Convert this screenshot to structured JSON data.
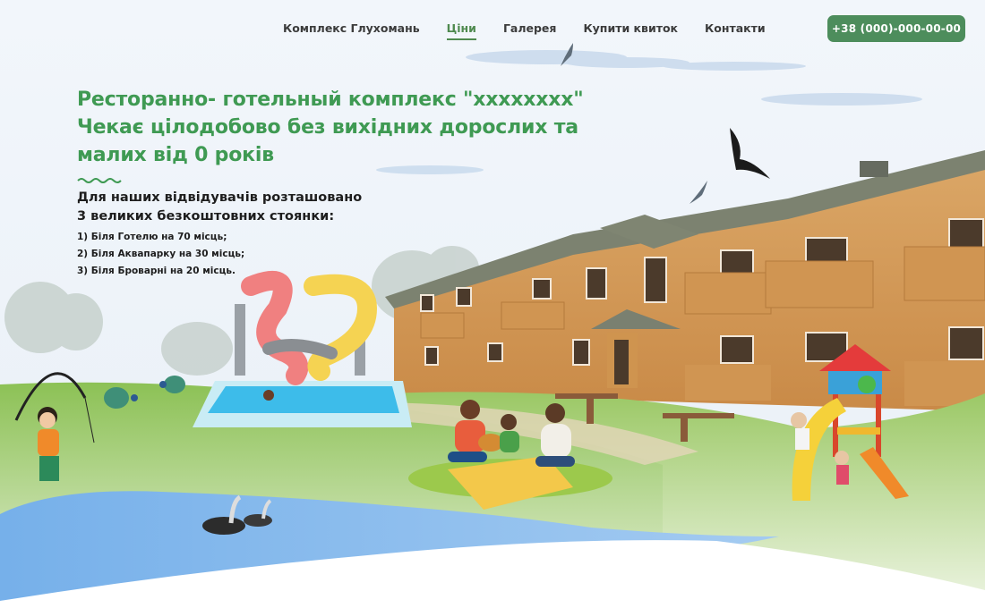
{
  "nav": {
    "items": [
      {
        "label": "Комплекс Глухомань",
        "active": false
      },
      {
        "label": "Ціни",
        "active": true
      },
      {
        "label": "Галерея",
        "active": false
      },
      {
        "label": "Купити квиток",
        "active": false
      },
      {
        "label": "Контакти",
        "active": false
      }
    ],
    "phone": "+38 (000)-000-00-00"
  },
  "hero": {
    "line1": "Ресторанно- готельный комплекс \"xxxxxxxx\"",
    "line2": "Чекає цілодобово без вихідних дорослих та",
    "line3": "малих від 0 років"
  },
  "parking": {
    "heading1": "Для наших відвідувачів розташовано",
    "heading2": "3 великих безкоштовних стоянки:",
    "items": [
      "1) Біля Готелю на 70 місць;",
      "2) Біля Аквапарку на 30 місць;",
      "3) Біля Броварні на 20 місць."
    ]
  },
  "colors": {
    "accent": "#4d8d5c",
    "title_green": "#3f9a53",
    "sky": "#eef4fa",
    "grass": "#8cc155",
    "water": "#7fb3ea",
    "wood": "#d49a5a"
  }
}
